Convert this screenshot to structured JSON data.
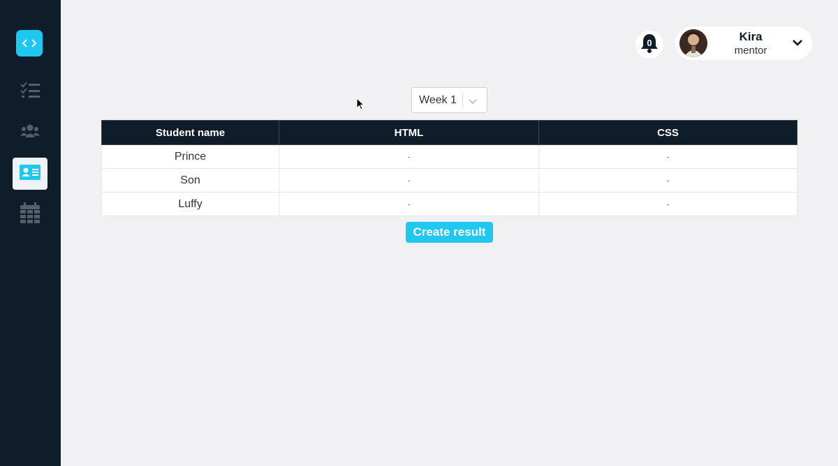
{
  "notifications": {
    "count": "0"
  },
  "user": {
    "name": "Kira",
    "role": "mentor"
  },
  "week_select": {
    "value": "Week 1"
  },
  "table": {
    "headers": [
      "Student name",
      "HTML",
      "CSS"
    ],
    "rows": [
      {
        "name": "Prince",
        "html": "-",
        "css": "-"
      },
      {
        "name": "Son",
        "html": "-",
        "css": "-"
      },
      {
        "name": "Luffy",
        "html": "-",
        "css": "-"
      }
    ]
  },
  "create_button": {
    "label": "Create result"
  },
  "colors": {
    "sidebar": "#0f1d2b",
    "accent": "#1ec8f0",
    "header_bg": "#0f1d2b"
  },
  "icons": [
    "code-icon",
    "checklist-icon",
    "users-icon",
    "id-card-icon",
    "calendar-icon",
    "bell-icon",
    "chevron-down-icon"
  ]
}
